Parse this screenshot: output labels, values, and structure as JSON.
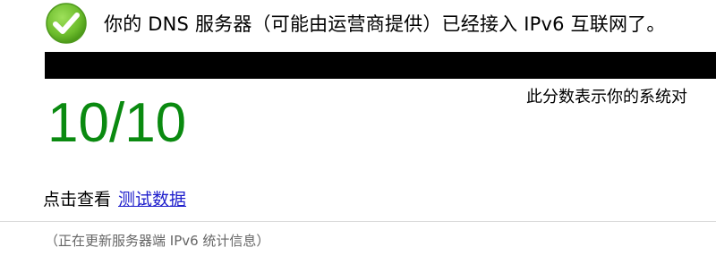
{
  "status": {
    "icon": "check-circle-icon",
    "icon_color": "#6cbc2c",
    "message": "你的 DNS 服务器（可能由运营商提供）已经接入 IPv6 互联网了。"
  },
  "score": {
    "value": "10/10",
    "color": "#0a8a10",
    "description": "此分数表示你的系统对"
  },
  "details": {
    "prefix": "点击查看",
    "link_label": "测试数据"
  },
  "stats_note": "（正在更新服务器端 IPv6 统计信息）"
}
